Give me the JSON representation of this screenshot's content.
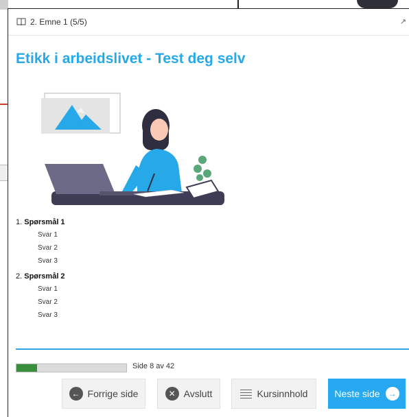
{
  "header": {
    "breadcrumb": "2. Emne 1 (5/5)",
    "book_icon": "book-icon",
    "collapse_icon": "collapse-icon"
  },
  "title": "Etikk i arbeidslivet - Test deg selv",
  "questions": [
    {
      "number": "1.",
      "text": "Spørsmål 1",
      "answers": [
        "Svar 1",
        "Svar 2",
        "Svar 3"
      ]
    },
    {
      "number": "2.",
      "text": "Spørsmål 2",
      "answers": [
        "Svar 1",
        "Svar 2",
        "Svar 3"
      ]
    }
  ],
  "progress": {
    "label": "Side 8 av 42",
    "current": 8,
    "total": 42,
    "color": "#3a8f3e"
  },
  "buttons": {
    "prev": "Forrige side",
    "quit": "Avslutt",
    "contents": "Kursinnhold",
    "next": "Neste side"
  },
  "colors": {
    "accent": "#27a8e8",
    "next_button": "#27a9f1",
    "divider": "#2aa7e6"
  }
}
